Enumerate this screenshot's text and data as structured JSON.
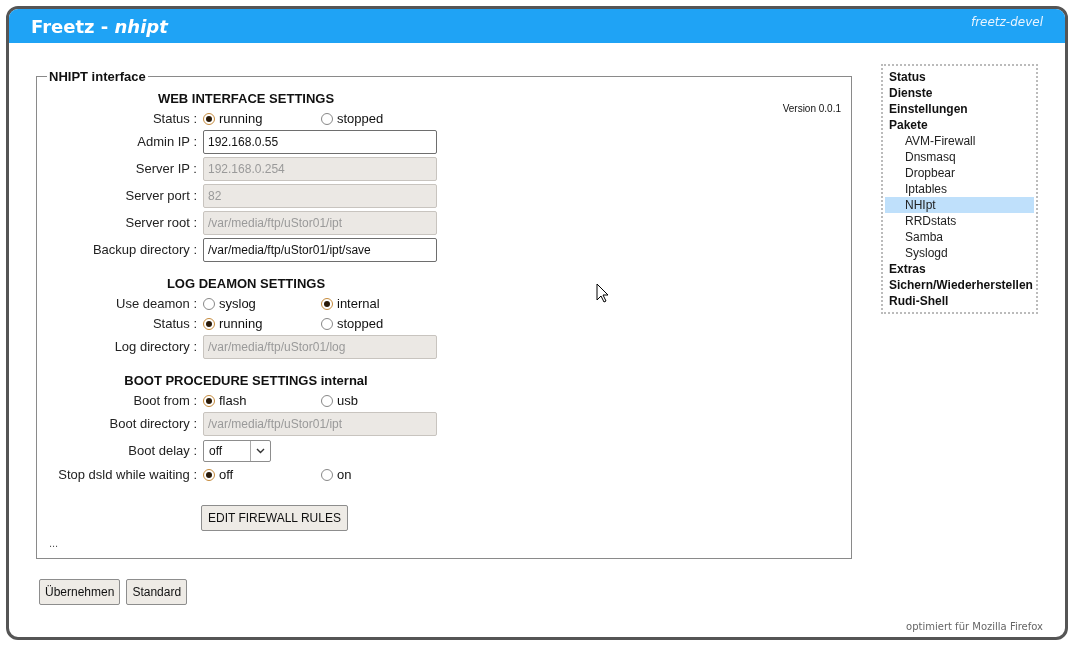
{
  "header": {
    "title": "Freetz - ",
    "title_emphasis": "nhipt",
    "subtitle": "freetz-devel"
  },
  "fieldset": {
    "legend": "NHIPT interface",
    "version": "Version 0.0.1",
    "sections": [
      {
        "heading": "WEB INTERFACE SETTINGS",
        "rows": [
          {
            "kind": "radio",
            "label": "Status :",
            "options": [
              {
                "label": "running",
                "selected": true
              },
              {
                "label": "stopped",
                "selected": false
              }
            ]
          },
          {
            "kind": "input",
            "label": "Admin IP :",
            "value": "192.168.0.55",
            "disabled": false
          },
          {
            "kind": "input",
            "label": "Server IP :",
            "value": "192.168.0.254",
            "disabled": true
          },
          {
            "kind": "input",
            "label": "Server port :",
            "value": "82",
            "disabled": true
          },
          {
            "kind": "input",
            "label": "Server root :",
            "value": "/var/media/ftp/uStor01/ipt",
            "disabled": true
          },
          {
            "kind": "input",
            "label": "Backup directory :",
            "value": "/var/media/ftp/uStor01/ipt/save",
            "disabled": false
          }
        ]
      },
      {
        "heading": "LOG DEAMON SETTINGS",
        "rows": [
          {
            "kind": "radio",
            "label": "Use deamon :",
            "options": [
              {
                "label": "syslog",
                "selected": false
              },
              {
                "label": "internal",
                "selected": true
              }
            ]
          },
          {
            "kind": "radio",
            "label": "Status :",
            "options": [
              {
                "label": "running",
                "selected": true
              },
              {
                "label": "stopped",
                "selected": false
              }
            ]
          },
          {
            "kind": "input",
            "label": "Log directory :",
            "value": "/var/media/ftp/uStor01/log",
            "disabled": true
          }
        ]
      },
      {
        "heading": "BOOT PROCEDURE SETTINGS internal",
        "rows": [
          {
            "kind": "radio",
            "label": "Boot from :",
            "options": [
              {
                "label": "flash",
                "selected": true
              },
              {
                "label": "usb",
                "selected": false
              }
            ]
          },
          {
            "kind": "input",
            "label": "Boot directory :",
            "value": "/var/media/ftp/uStor01/ipt",
            "disabled": true
          },
          {
            "kind": "select",
            "label": "Boot delay :",
            "value": "off"
          },
          {
            "kind": "radio",
            "label": "Stop dsld while waiting :",
            "options": [
              {
                "label": "off",
                "selected": true
              },
              {
                "label": "on",
                "selected": false
              }
            ]
          }
        ]
      }
    ],
    "action_button": "EDIT FIREWALL RULES",
    "ellipsis": "..."
  },
  "buttons": [
    "Übernehmen",
    "Standard"
  ],
  "footer": "optimiert für Mozilla Firefox",
  "sidebar": {
    "items": [
      {
        "label": "Status",
        "selected": false
      },
      {
        "label": "Dienste",
        "selected": false
      },
      {
        "label": "Einstellungen",
        "selected": false
      },
      {
        "label": "Pakete",
        "selected": false,
        "children": [
          {
            "label": "AVM-Firewall",
            "selected": false
          },
          {
            "label": "Dnsmasq",
            "selected": false
          },
          {
            "label": "Dropbear",
            "selected": false
          },
          {
            "label": "Iptables",
            "selected": false
          },
          {
            "label": "NHIpt",
            "selected": true
          },
          {
            "label": "RRDstats",
            "selected": false
          },
          {
            "label": "Samba",
            "selected": false
          },
          {
            "label": "Syslogd",
            "selected": false
          }
        ]
      },
      {
        "label": "Extras",
        "selected": false
      },
      {
        "label": "Sichern/Wiederherstellen",
        "selected": false
      },
      {
        "label": "Rudi-Shell",
        "selected": false
      }
    ]
  }
}
